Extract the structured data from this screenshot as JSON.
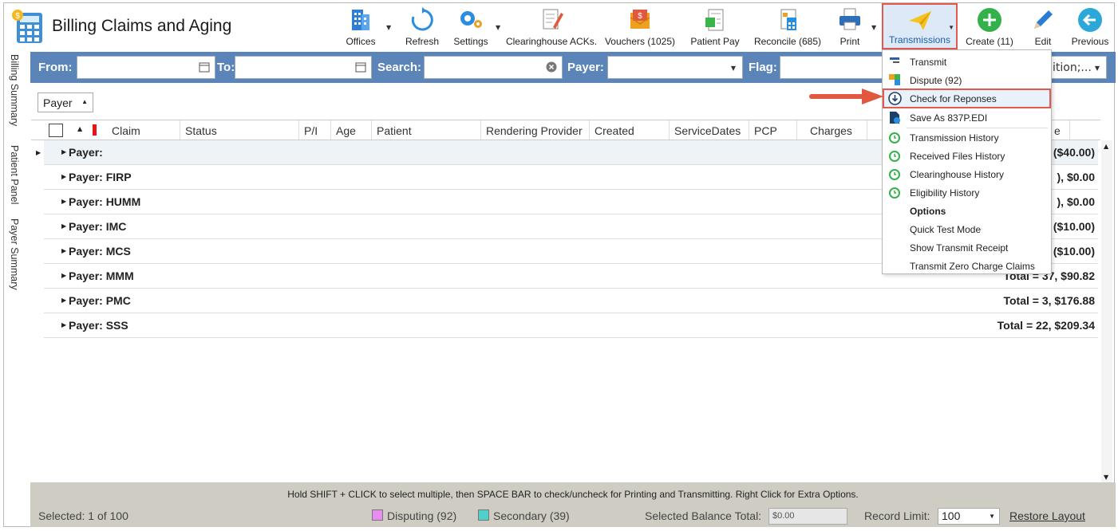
{
  "app": {
    "title": "Billing Claims and Aging"
  },
  "toolbar": {
    "offices": "Offices",
    "refresh": "Refresh",
    "settings": "Settings",
    "clearinghouse": "Clearinghouse ACKs.",
    "vouchers": "Vouchers (1025)",
    "patient_pay": "Patient Pay",
    "reconcile": "Reconcile (685)",
    "print": "Print",
    "transmissions": "Transmissions",
    "create": "Create (11)",
    "edit": "Edit",
    "previous": "Previous"
  },
  "filter": {
    "from_label": "From:",
    "to_label": "To:",
    "search_label": "Search:",
    "payer_label": "Payer:",
    "flag_label": "Flag:",
    "right_value": "ition;..."
  },
  "side_tabs": [
    "Billing Summary",
    "Patient Panel",
    "Payer Summary"
  ],
  "group_by": "Payer",
  "columns": [
    "Claim",
    "Status",
    "P/I",
    "Age",
    "Patient",
    "Rendering Provider",
    "Created",
    "ServiceDates",
    "PCP",
    "Charges",
    "e"
  ],
  "rows": [
    {
      "label": "Payer:",
      "total": "($40.00)"
    },
    {
      "label": "Payer: FIRP",
      "total": "), $0.00"
    },
    {
      "label": "Payer: HUMM",
      "total": "), $0.00"
    },
    {
      "label": "Payer: IMC",
      "total": "($10.00)"
    },
    {
      "label": "Payer: MCS",
      "total": "($10.00)"
    },
    {
      "label": "Payer: MMM",
      "total": "Total = 37,  $90.82"
    },
    {
      "label": "Payer: PMC",
      "total": "Total = 3,  $176.88"
    },
    {
      "label": "Payer: SSS",
      "total": "Total = 22,  $209.34"
    }
  ],
  "menu": {
    "items": [
      {
        "label": "Transmit"
      },
      {
        "label": "Dispute (92)"
      },
      {
        "label": "Check for Reponses"
      },
      {
        "label": "Save As 837P.EDI"
      },
      {
        "label": "Transmission History"
      },
      {
        "label": "Received Files History"
      },
      {
        "label": "Clearinghouse History"
      },
      {
        "label": "Eligibility History"
      },
      {
        "label": "Options"
      },
      {
        "label": "Quick Test Mode"
      },
      {
        "label": "Show Transmit Receipt"
      },
      {
        "label": "Transmit Zero Charge Claims"
      }
    ]
  },
  "footer": {
    "hint": "Hold SHIFT + CLICK to select multiple, then SPACE BAR to check/uncheck for Printing and Transmitting. Right Click for Extra Options.",
    "selected": "Selected: 1 of 100",
    "disputing": "Disputing (92)",
    "secondary": "Secondary (39)",
    "balance_label": "Selected Balance Total:",
    "balance_value": "$0.00",
    "record_limit_label": "Record Limit:",
    "record_limit_value": "100",
    "restore": "Restore Layout"
  },
  "colors": {
    "filter_bar": "#5b84b8",
    "highlight": "#e05a4f",
    "disputing": "#e68ef0",
    "secondary": "#4fd1c9"
  }
}
